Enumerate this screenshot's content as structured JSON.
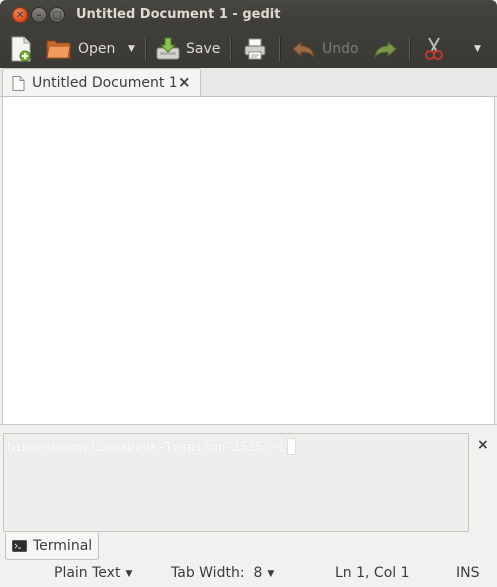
{
  "window": {
    "title": "Untitled Document 1 - gedit"
  },
  "toolbar": {
    "new_icon": "new-document-icon",
    "open_label": "Open",
    "save_label": "Save",
    "print_icon": "print-icon",
    "undo_label": "Undo",
    "redo_icon": "redo-icon",
    "cut_icon": "cut-icon",
    "more_icon": "dropdown-arrow-icon"
  },
  "tabs": [
    {
      "label": "Untitled Document 1",
      "close": "×"
    }
  ],
  "editor": {
    "content": ""
  },
  "terminal": {
    "prompt": "himanshu@mylinuxbook-Inspiron-1525:~$",
    "tab_label": "Terminal",
    "close": "×"
  },
  "statusbar": {
    "language": "Plain Text",
    "tab_width": "Tab Width:  8",
    "position": "Ln 1, Col 1",
    "mode": "INS"
  },
  "colors": {
    "titlebar": "#3c3b37",
    "close_button": "#dd4814",
    "background": "#f2f1f0"
  }
}
